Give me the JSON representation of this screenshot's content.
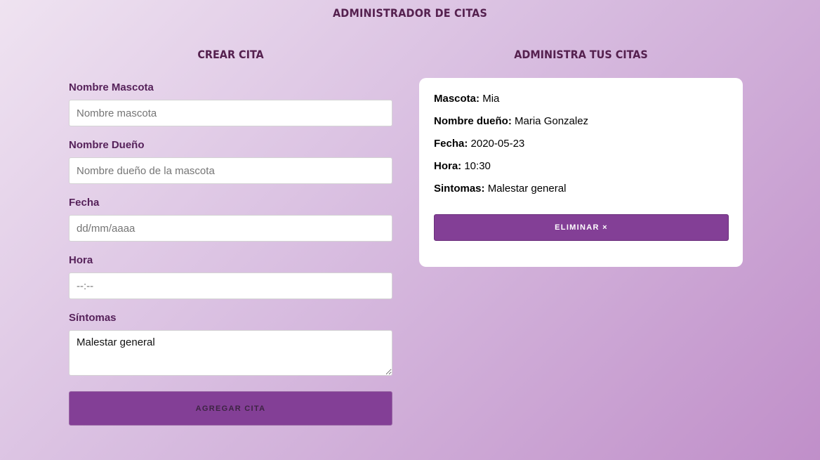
{
  "app": {
    "title": "ADMINISTRADOR DE CITAS"
  },
  "form": {
    "title": "CREAR CITA",
    "fields": [
      {
        "label": "Nombre Mascota",
        "placeholder": "Nombre mascota",
        "value": ""
      },
      {
        "label": "Nombre Dueño",
        "placeholder": "Nombre dueño de la mascota",
        "value": ""
      },
      {
        "label": "Fecha",
        "placeholder": "dd/mm/aaaa",
        "value": ""
      },
      {
        "label": "Hora",
        "placeholder": "--:--",
        "value": ""
      },
      {
        "label": "Síntomas",
        "value": "Malestar general"
      }
    ],
    "submit_label": "AGREGAR CITA"
  },
  "appointments": {
    "title": "ADMINISTRA TUS CITAS",
    "items": [
      {
        "pet_label": "Mascota:",
        "pet": "Mia",
        "owner_label": "Nombre dueño:",
        "owner": "Maria Gonzalez",
        "date_label": "Fecha:",
        "date": "2020-05-23",
        "time_label": "Hora:",
        "time": "10:30",
        "symptoms_label": "Sintomas:",
        "symptoms": "Malestar general",
        "delete_label": "ELIMINAR ×"
      }
    ]
  },
  "colors": {
    "accent": "#833f96",
    "heading": "#55214f",
    "label": "#56225a",
    "background_start": "#efe3f1",
    "background_end": "#c08fc9"
  }
}
